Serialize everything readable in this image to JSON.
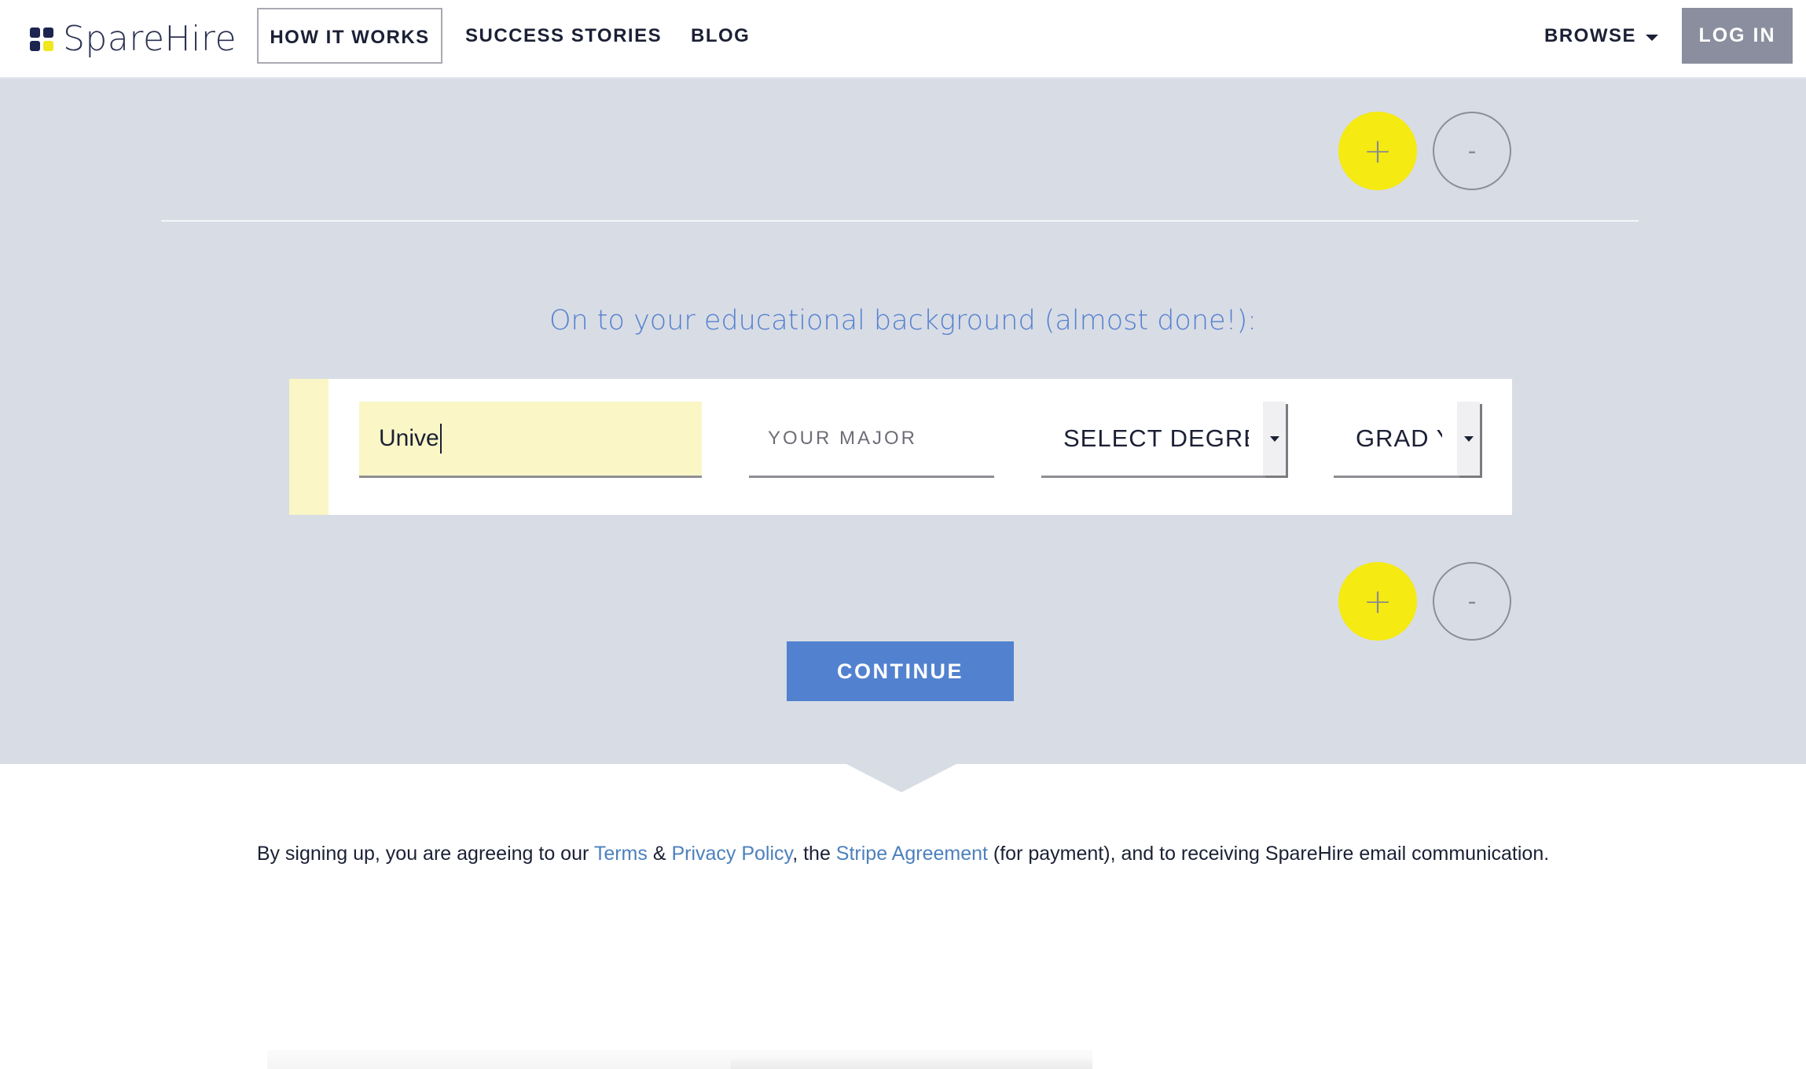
{
  "header": {
    "logo_text": "SpareHire",
    "nav": {
      "how_it_works": "HOW IT WORKS",
      "success_stories": "SUCCESS STORIES",
      "blog": "BLOG",
      "browse": "BROWSE"
    },
    "login_label": "LOG IN"
  },
  "top_controls": {
    "add_symbol": "+",
    "remove_symbol": "-"
  },
  "education": {
    "heading": "On to your educational background (almost done!):",
    "university_value": "Unive",
    "major_placeholder": "YOUR MAJOR",
    "degree_selected": "SELECT DEGREE",
    "grad_year_selected": "GRAD YEAR",
    "add_symbol": "+",
    "remove_symbol": "-"
  },
  "continue_label": "CONTINUE",
  "terms": {
    "prefix": "By signing up, you are agreeing to our ",
    "terms_link": "Terms",
    "amp": " & ",
    "privacy_link": "Privacy Policy",
    "middle": ", the ",
    "stripe_link": "Stripe Agreement",
    "suffix": " (for payment), and to receiving SpareHire email communication."
  },
  "colors": {
    "accent_blue": "#5282cf",
    "brand_yellow": "#f5ea12",
    "section_gray": "#d8dce5",
    "navy": "#1b2035"
  }
}
